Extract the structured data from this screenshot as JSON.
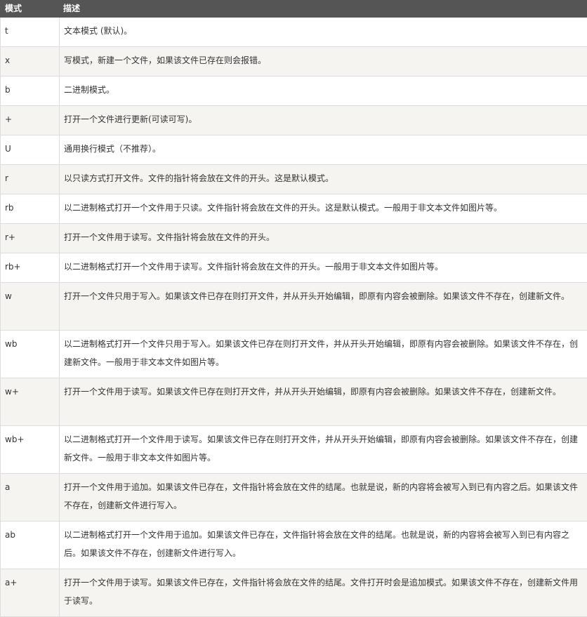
{
  "table": {
    "headers": {
      "mode": "模式",
      "description": "描述"
    },
    "rows": [
      {
        "mode": "t",
        "description": "文本模式 (默认)。"
      },
      {
        "mode": "x",
        "description": "写模式，新建一个文件，如果该文件已存在则会报错。"
      },
      {
        "mode": "b",
        "description": "二进制模式。"
      },
      {
        "mode": "+",
        "description": "打开一个文件进行更新(可读可写)。"
      },
      {
        "mode": "U",
        "description": "通用换行模式（不推荐）。"
      },
      {
        "mode": "r",
        "description": "以只读方式打开文件。文件的指针将会放在文件的开头。这是默认模式。"
      },
      {
        "mode": "rb",
        "description": "以二进制格式打开一个文件用于只读。文件指针将会放在文件的开头。这是默认模式。一般用于非文本文件如图片等。"
      },
      {
        "mode": "r+",
        "description": "打开一个文件用于读写。文件指针将会放在文件的开头。"
      },
      {
        "mode": "rb+",
        "description": "以二进制格式打开一个文件用于读写。文件指针将会放在文件的开头。一般用于非文本文件如图片等。"
      },
      {
        "mode": "w",
        "description": "打开一个文件只用于写入。如果该文件已存在则打开文件，并从开头开始编辑，即原有内容会被删除。如果该文件不存在，创建新文件。"
      },
      {
        "mode": "wb",
        "description": "以二进制格式打开一个文件只用于写入。如果该文件已存在则打开文件，并从开头开始编辑，即原有内容会被删除。如果该文件不存在，创建新文件。一般用于非文本文件如图片等。"
      },
      {
        "mode": "w+",
        "description": "打开一个文件用于读写。如果该文件已存在则打开文件，并从开头开始编辑，即原有内容会被删除。如果该文件不存在，创建新文件。"
      },
      {
        "mode": "wb+",
        "description": "以二进制格式打开一个文件用于读写。如果该文件已存在则打开文件，并从开头开始编辑，即原有内容会被删除。如果该文件不存在，创建新文件。一般用于非文本文件如图片等。"
      },
      {
        "mode": "a",
        "description": "打开一个文件用于追加。如果该文件已存在，文件指针将会放在文件的结尾。也就是说，新的内容将会被写入到已有内容之后。如果该文件不存在，创建新文件进行写入。"
      },
      {
        "mode": "ab",
        "description": "以二进制格式打开一个文件用于追加。如果该文件已存在，文件指针将会放在文件的结尾。也就是说，新的内容将会被写入到已有内容之后。如果该文件不存在，创建新文件进行写入。"
      },
      {
        "mode": "a+",
        "description": "打开一个文件用于读写。如果该文件已存在，文件指针将会放在文件的结尾。文件打开时会是追加模式。如果该文件不存在，创建新文件用于读写。"
      }
    ]
  }
}
